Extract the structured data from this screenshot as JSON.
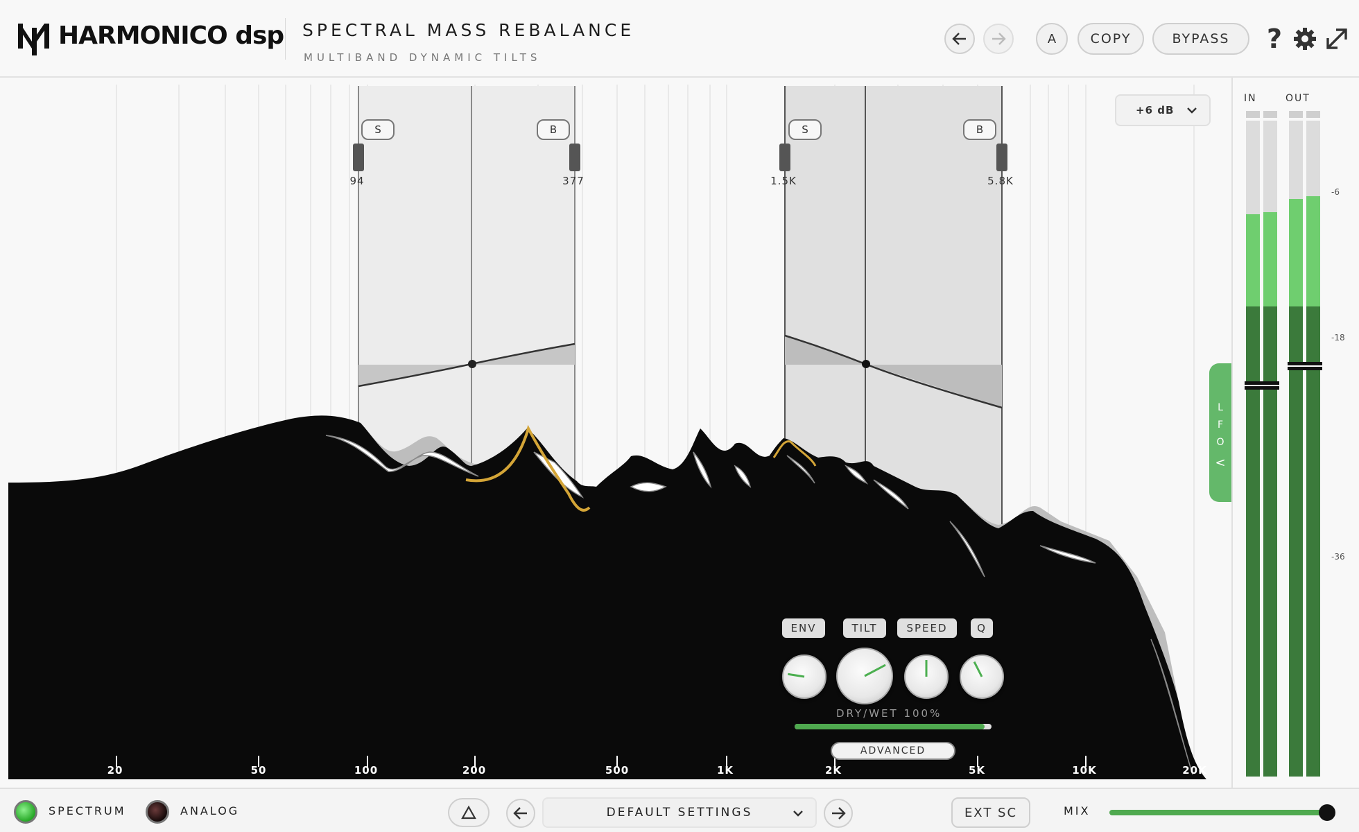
{
  "header": {
    "brand": "HARMONICO dsp",
    "title": "SPECTRAL MASS REBALANCE",
    "subtitle": "MULTIBAND DYNAMIC TILTS",
    "undo_icon": "arrow-left-icon",
    "redo_icon": "arrow-right-icon",
    "ab_label": "A",
    "copy_label": "COPY",
    "bypass_label": "BYPASS",
    "help_label": "?"
  },
  "display": {
    "range_label": "+6 dB",
    "freq_axis": [
      "20",
      "50",
      "100",
      "200",
      "500",
      "1K",
      "2K",
      "5K",
      "10K",
      "20K"
    ],
    "bands": [
      {
        "solo": "S",
        "bypass": "B",
        "low": "94",
        "high": "377"
      },
      {
        "solo": "S",
        "bypass": "B",
        "low": "1.5K",
        "high": "5.8K"
      }
    ]
  },
  "controls": {
    "env_label": "ENV",
    "tilt_label": "TILT",
    "speed_label": "SPEED",
    "q_label": "Q",
    "knob_env": 0.2,
    "knob_tilt": 0.73,
    "knob_speed": 0.5,
    "knob_q": 0.4,
    "drywet_label": "DRY/WET  100%",
    "drywet_value": 1.0,
    "advanced_label": "ADVANCED"
  },
  "lfo": {
    "letters": [
      "L",
      "F",
      "O"
    ],
    "arrow": "<"
  },
  "meters": {
    "in_label": "IN",
    "out_label": "OUT",
    "scale": [
      "-6",
      "-18",
      "-36"
    ],
    "in_levels": [
      0.845,
      0.848
    ],
    "out_levels": [
      0.868,
      0.872
    ],
    "in_threshold_db": -29,
    "out_threshold_db": -27
  },
  "footer": {
    "spectrum_label": "SPECTRUM",
    "analog_label": "ANALOG",
    "compare_icon": "triangle-icon",
    "preset_name": "DEFAULT SETTINGS",
    "extsc_label": "EXT SC",
    "mix_label": "MIX",
    "mix_value": 1.0
  },
  "colors": {
    "accent_green": "#4fa94f",
    "meter_bright": "#6fce6f",
    "meter_dark": "#3b7a3b",
    "spectrum_fill": "#0a0a0a",
    "highlight_gold": "#d4a537"
  }
}
